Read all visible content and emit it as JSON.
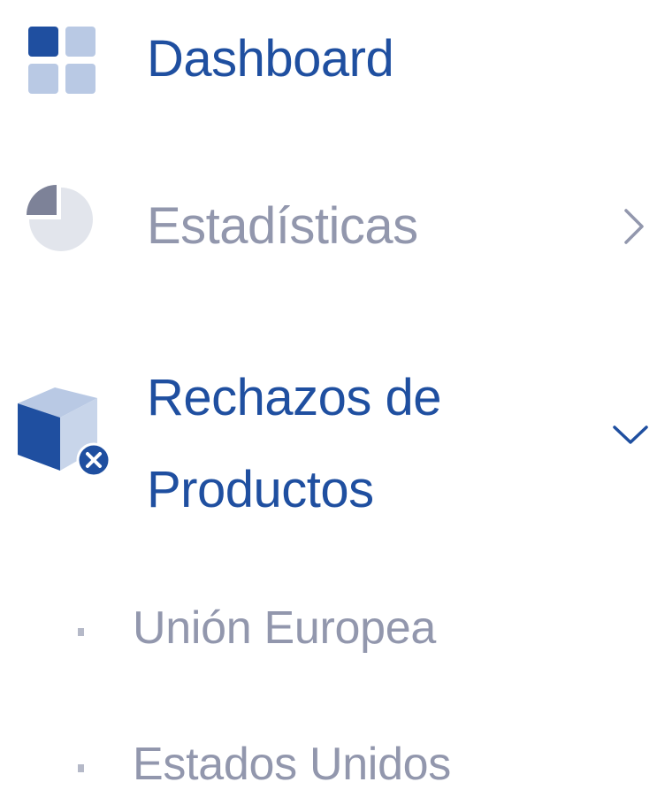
{
  "sidebar": {
    "items": [
      {
        "label": "Dashboard",
        "icon": "dashboard-grid-icon",
        "state": "active"
      },
      {
        "label": "Estadísticas",
        "icon": "pie-chart-icon",
        "state": "collapsed",
        "chevron": "chevron-right-icon"
      },
      {
        "label": "Rechazos de Productos",
        "icon": "rejected-box-icon",
        "state": "expanded",
        "chevron": "chevron-down-icon",
        "children": [
          {
            "label": "Unión Europea"
          },
          {
            "label": "Estados Unidos"
          }
        ]
      }
    ]
  },
  "colors": {
    "active_text": "#1f4fa0",
    "muted_text": "#9297ad",
    "icon_dark": "#1f4fa0",
    "icon_light": "#b9c9e4",
    "pie_light": "#e2e5ec",
    "pie_dark": "#7d8298"
  }
}
